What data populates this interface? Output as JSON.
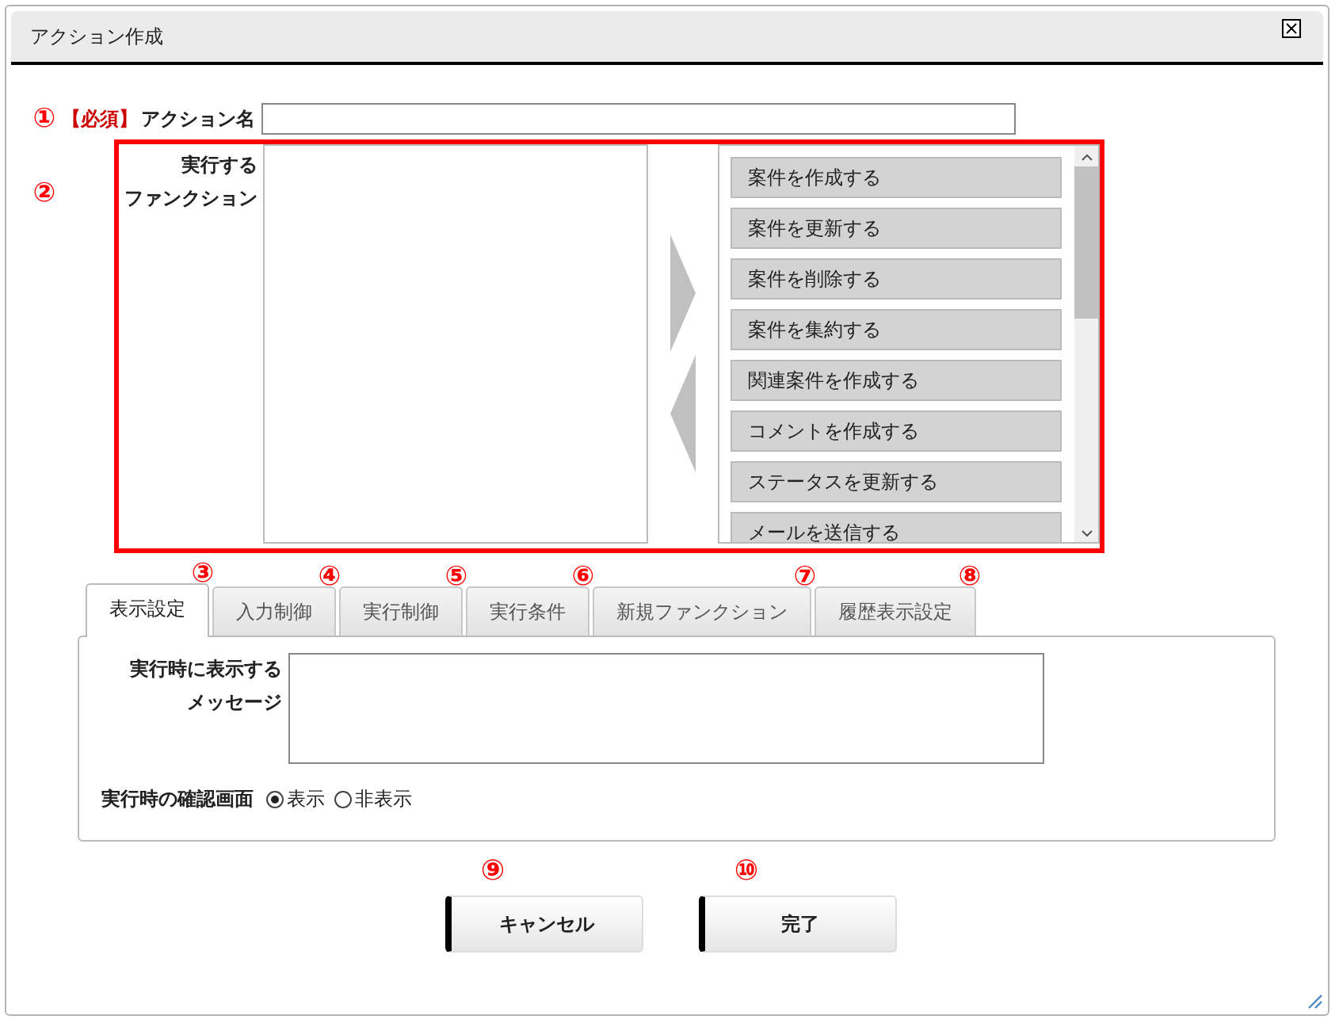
{
  "dialog": {
    "title": "アクション作成"
  },
  "action_name": {
    "callout": "①",
    "required": "【必須】",
    "label": "アクション名"
  },
  "functions": {
    "callout": "②",
    "label_lines": [
      "実行する",
      "ファンクション"
    ],
    "available": [
      {
        "label": "案件を作成する"
      },
      {
        "label": "案件を更新する"
      },
      {
        "label": "案件を削除する"
      },
      {
        "label": "案件を集約する"
      },
      {
        "label": "関連案件を作成する"
      },
      {
        "label": "コメントを作成する"
      },
      {
        "label": "ステータスを更新する"
      },
      {
        "label": "メールを送信する"
      }
    ]
  },
  "tabs": [
    {
      "label": "表示設定",
      "callout": "③",
      "selected": true
    },
    {
      "label": "入力制御",
      "callout": "④",
      "selected": false
    },
    {
      "label": "実行制御",
      "callout": "⑤",
      "selected": false
    },
    {
      "label": "実行条件",
      "callout": "⑥",
      "selected": false
    },
    {
      "label": "新規ファンクション",
      "callout": "⑦",
      "selected": false
    },
    {
      "label": "履歴表示設定",
      "callout": "⑧",
      "selected": false
    }
  ],
  "message": {
    "label_lines": [
      "実行時に表示する",
      "メッセージ"
    ]
  },
  "confirm": {
    "label": "実行時の確認画面",
    "options": [
      {
        "label": "表示",
        "selected": true
      },
      {
        "label": "非表示",
        "selected": false
      }
    ]
  },
  "buttons": [
    {
      "label": "キャンセル",
      "callout": "⑨"
    },
    {
      "label": "完了",
      "callout": "⑩"
    }
  ]
}
